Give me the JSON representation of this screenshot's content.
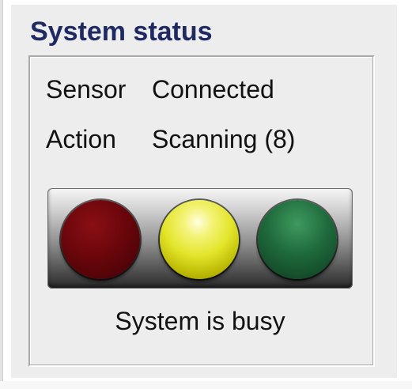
{
  "panel": {
    "title": "System status",
    "rows": [
      {
        "label": "Sensor",
        "value": "Connected"
      },
      {
        "label": "Action",
        "value": "Scanning (8)"
      }
    ],
    "traffic_light": {
      "active": "yellow",
      "colors": {
        "red": "#6a060b",
        "yellow": "#e3e52a",
        "green": "#1f6a3c"
      }
    },
    "status_message": "System is busy"
  }
}
